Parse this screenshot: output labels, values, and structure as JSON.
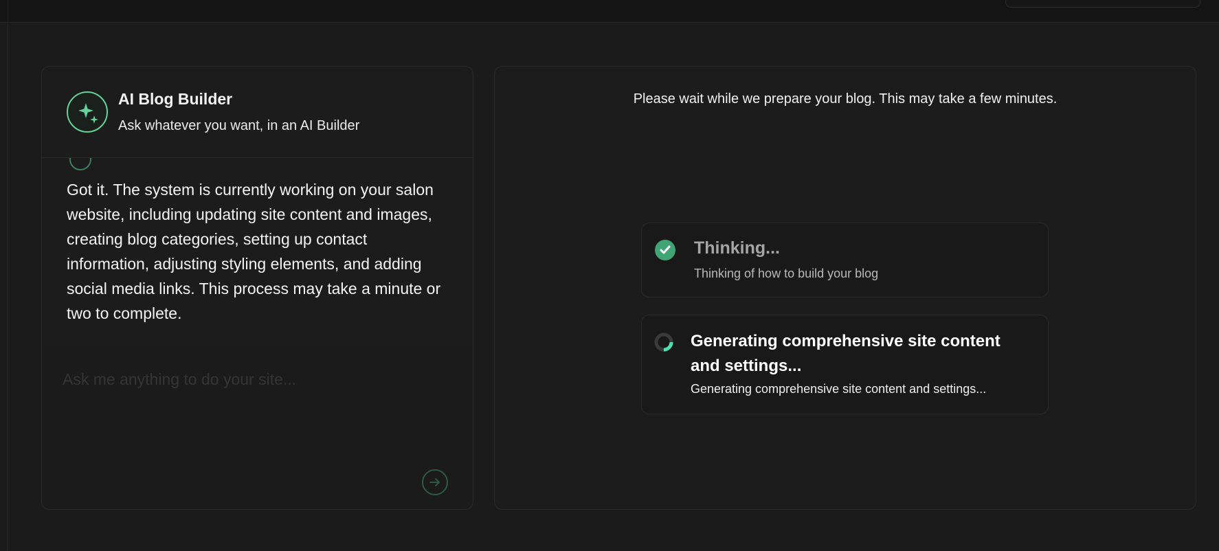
{
  "colors": {
    "accent": "#62d49b",
    "success": "#3fa574",
    "background": "#1b1b1b",
    "panel": "#1c1c1c"
  },
  "chat": {
    "title": "AI Blog Builder",
    "subtitle": "Ask whatever you want, in an AI Builder",
    "avatar_icon": "sparkles-icon",
    "message": "Got it. The system is currently working on your salon website, including updating site content and images, creating blog categories, setting up contact information, adjusting styling elements, and adding social media links. This process may take a minute or two to complete.",
    "input": {
      "placeholder": "Ask me anything to do your site...",
      "value": ""
    },
    "send_icon": "arrow-right-circle-icon"
  },
  "preview": {
    "notice": "Please wait while we prepare your blog. This may take a few minutes.",
    "steps": [
      {
        "status": "done",
        "icon": "check-circle-icon",
        "title": "Thinking...",
        "description": "Thinking of how to build your blog"
      },
      {
        "status": "in-progress",
        "icon": "spinner-icon",
        "title": "Generating comprehensive site content and settings...",
        "description": "Generating comprehensive site content and settings..."
      }
    ]
  }
}
